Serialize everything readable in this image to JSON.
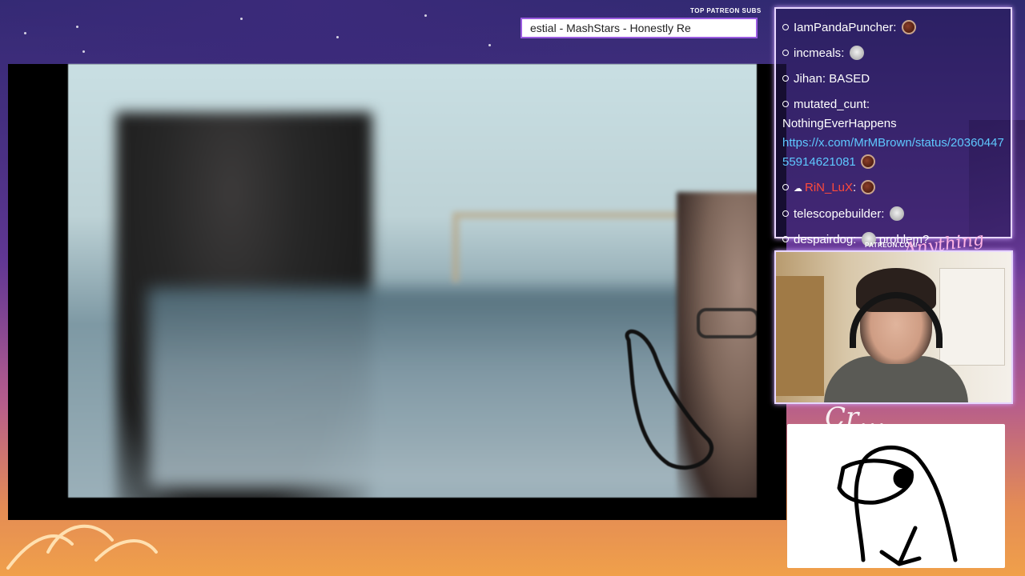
{
  "ticker": {
    "label": "TOP PATREON SUBS",
    "text": "estial - MashStars - Honestly Re"
  },
  "chat": {
    "messages": [
      {
        "user": "IamPandaPuncher",
        "sep": ":",
        "text": "",
        "emote": "brown-orb-emote"
      },
      {
        "user": "incmeals",
        "sep": ":",
        "text": "",
        "emote": "face-emote"
      },
      {
        "user": "Jihan",
        "sep": ":",
        "text": "BASED",
        "emote": ""
      },
      {
        "user": "mutated_cunt",
        "sep": ":",
        "text": "NothingEverHappens",
        "link": "https://x.com/MrMBrown/status/2036044755914621081",
        "emote": "brown-orb-emote"
      },
      {
        "user": "RiN_LuX",
        "sep": ":",
        "text": "",
        "emote": "brown-orb-emote",
        "user_color": "#ff4a3a"
      },
      {
        "user": "telescopebuilder",
        "sep": ":",
        "text": "",
        "emote": "face-emote"
      },
      {
        "user": "despairdog",
        "sep": ":",
        "text": "problem?",
        "emote": "face-emote"
      }
    ]
  },
  "patreon": {
    "url": "PATREON.COM/",
    "signature": "Anything else"
  },
  "colors": {
    "accent_border": "#e7d6ff",
    "link": "#5ec8ff",
    "ticker_border": "#9a5be0"
  }
}
